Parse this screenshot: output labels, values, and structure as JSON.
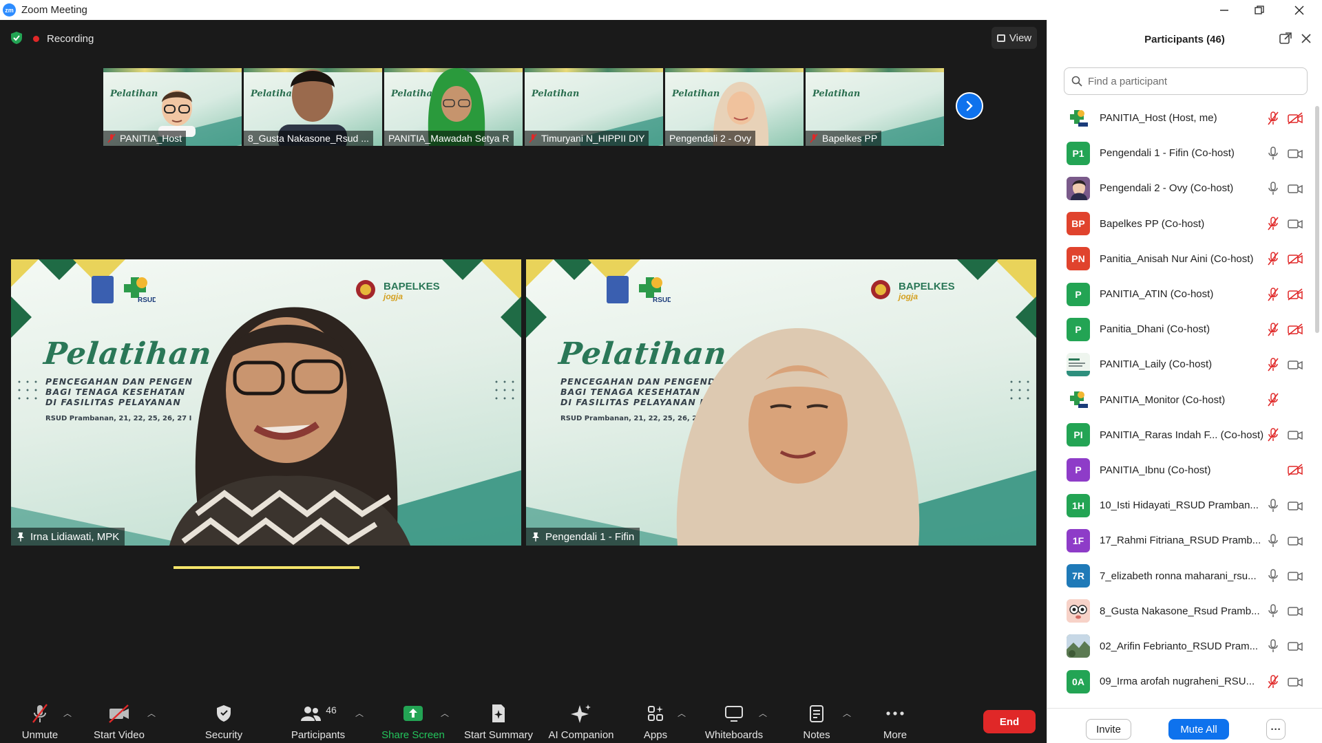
{
  "window": {
    "title": "Zoom Meeting",
    "logo_text": "zm"
  },
  "status": {
    "recording_label": "Recording"
  },
  "view_button": {
    "label": "View"
  },
  "thumbnails": [
    {
      "name": "PANITIA_Host",
      "muted": true,
      "slide_text": "Pelatihan"
    },
    {
      "name": "8_Gusta Nakasone_Rsud ...",
      "muted": false,
      "slide_text": "Pelatihan"
    },
    {
      "name": "PANITIA_Mawadah Setya R",
      "muted": false,
      "slide_text": "Pelatihan"
    },
    {
      "name": "Timuryani N_HIPPII DIY",
      "muted": true,
      "slide_text": "Pelatihan"
    },
    {
      "name": "Pengendali 2 - Ovy",
      "muted": false,
      "slide_text": "Pelatihan"
    },
    {
      "name": "Bapelkes PP",
      "muted": true,
      "slide_text": "Pelatihan"
    }
  ],
  "tiles": [
    {
      "name": "Irna Lidiawati, MPK",
      "slide": {
        "title": "Pelatihan",
        "line1": "PENCEGAHAN DAN PENGEN",
        "line2": "BAGI TENAGA KESEHATAN",
        "line3": "DI FASILITAS PELAYANAN",
        "place": "RSUD Prambanan, 21, 22, 25, 26, 27 I",
        "rsud": "RSUD",
        "bapelkes": "BAPELKES",
        "jogja": "jogja"
      }
    },
    {
      "name": "Pengendali 1 - Fifin",
      "slide": {
        "title": "Pelatihan",
        "line1": "PENCEGAHAN DAN PENGENDA",
        "line2": "BAGI TENAGA KESEHATAN",
        "line3": "DI FASILITAS PELAYANAN KES",
        "place": "RSUD Prambanan, 21, 22, 25, 26, 27 Maret",
        "rsud": "RSUD",
        "bapelkes": "BAPELKES",
        "jogja": "jogja"
      }
    }
  ],
  "toolbar": {
    "unmute": "Unmute",
    "start_video": "Start Video",
    "security": "Security",
    "participants": "Participants",
    "participants_count": "46",
    "share_screen": "Share Screen",
    "start_summary": "Start Summary",
    "ai_companion": "AI Companion",
    "apps": "Apps",
    "whiteboards": "Whiteboards",
    "notes": "Notes",
    "more": "More",
    "end": "End"
  },
  "panel": {
    "title": "Participants (46)",
    "search_placeholder": "Find a participant",
    "participants": [
      {
        "name": "PANITIA_Host (Host, me)",
        "initials": "",
        "avatar": "logo",
        "color": "#ffffff",
        "mic": "muted",
        "cam": "off"
      },
      {
        "name": "Pengendali 1 - Fifin (Co-host)",
        "initials": "P1",
        "avatar": "initials",
        "color": "#23a454",
        "mic": "on",
        "cam": "on"
      },
      {
        "name": "Pengendali 2 - Ovy (Co-host)",
        "initials": "",
        "avatar": "photo",
        "color": "#7a5a8a",
        "mic": "on",
        "cam": "on"
      },
      {
        "name": "Bapelkes PP (Co-host)",
        "initials": "BP",
        "avatar": "initials",
        "color": "#e0432d",
        "mic": "muted",
        "cam": "on"
      },
      {
        "name": "Panitia_Anisah Nur Aini (Co-host)",
        "initials": "PN",
        "avatar": "initials",
        "color": "#e0432d",
        "mic": "muted",
        "cam": "off"
      },
      {
        "name": "PANITIA_ATIN (Co-host)",
        "initials": "P",
        "avatar": "initials",
        "color": "#23a454",
        "mic": "muted",
        "cam": "off"
      },
      {
        "name": "Panitia_Dhani (Co-host)",
        "initials": "P",
        "avatar": "initials",
        "color": "#23a454",
        "mic": "muted",
        "cam": "off"
      },
      {
        "name": "PANITIA_Laily (Co-host)",
        "initials": "",
        "avatar": "slide",
        "color": "#dfe9e4",
        "mic": "muted",
        "cam": "on"
      },
      {
        "name": "PANITIA_Monitor (Co-host)",
        "initials": "",
        "avatar": "logo",
        "color": "#ffffff",
        "mic": "muted",
        "cam": "none"
      },
      {
        "name": "PANITIA_Raras Indah F... (Co-host)",
        "initials": "PI",
        "avatar": "initials",
        "color": "#23a454",
        "mic": "muted",
        "cam": "on"
      },
      {
        "name": "PANITIA_Ibnu (Co-host)",
        "initials": "P",
        "avatar": "initials",
        "color": "#8e3cc8",
        "mic": "none",
        "cam": "off"
      },
      {
        "name": "10_Isti Hidayati_RSUD Pramban...",
        "initials": "1H",
        "avatar": "initials",
        "color": "#23a454",
        "mic": "on",
        "cam": "on"
      },
      {
        "name": "17_Rahmi Fitriana_RSUD Pramb...",
        "initials": "1F",
        "avatar": "initials",
        "color": "#8e3cc8",
        "mic": "on",
        "cam": "on"
      },
      {
        "name": "7_elizabeth ronna maharani_rsu...",
        "initials": "7R",
        "avatar": "initials",
        "color": "#1f7ab8",
        "mic": "on",
        "cam": "on"
      },
      {
        "name": "8_Gusta Nakasone_Rsud Pramb...",
        "initials": "",
        "avatar": "emoji",
        "color": "#f3c1b7",
        "mic": "on",
        "cam": "on"
      },
      {
        "name": "02_Arifin Febrianto_RSUD Pram...",
        "initials": "",
        "avatar": "landscape",
        "color": "#5b7a52",
        "mic": "on",
        "cam": "on"
      },
      {
        "name": "09_Irma arofah nugraheni_RSU...",
        "initials": "0A",
        "avatar": "initials",
        "color": "#23a454",
        "mic": "muted",
        "cam": "on"
      }
    ],
    "invite": "Invite",
    "mute_all": "Mute All",
    "more": "···"
  },
  "colors": {
    "accent": "#0e72ed",
    "end": "#e02828",
    "mute_red": "#e02828",
    "green": "#23a454"
  }
}
